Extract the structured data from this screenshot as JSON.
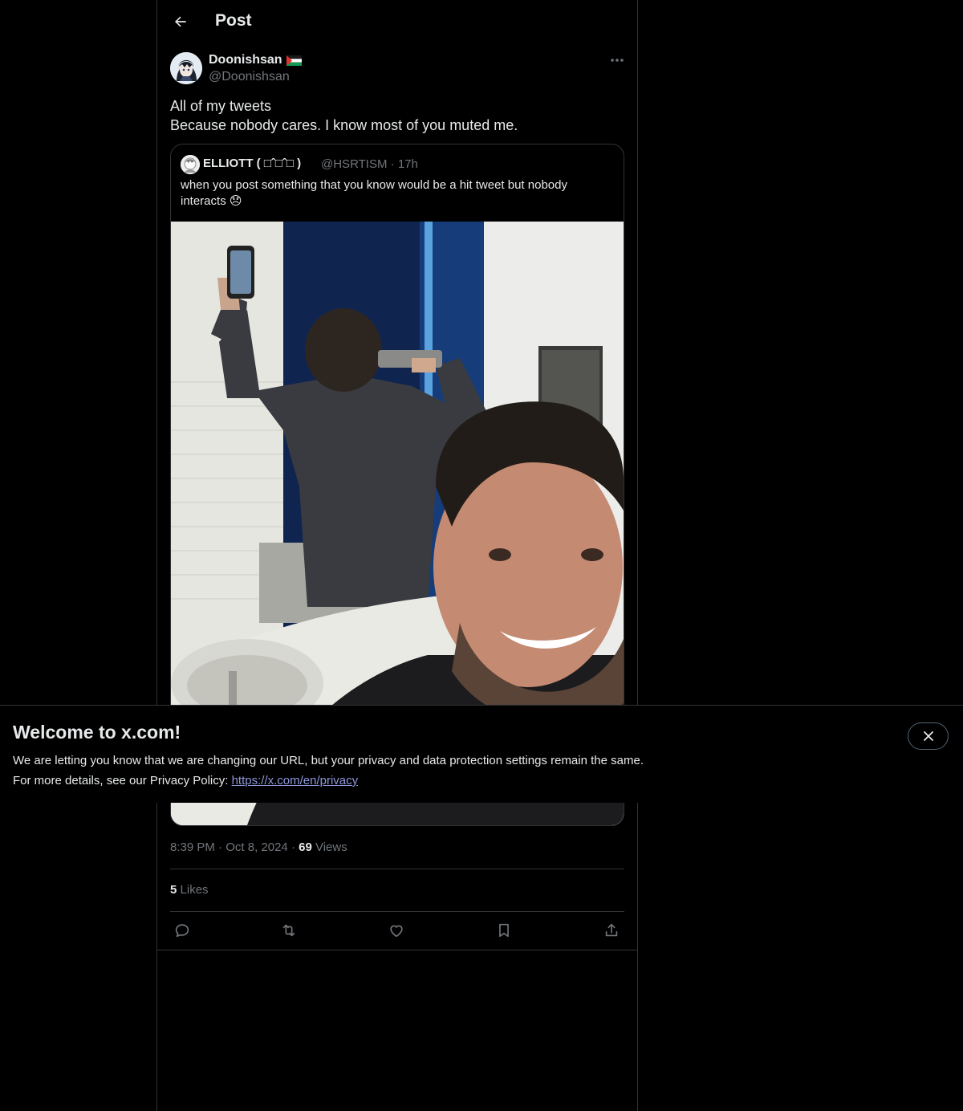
{
  "header": {
    "title": "Post"
  },
  "tweet": {
    "author_name": "Doonishsan",
    "author_flag": "🇵🇸",
    "author_handle": "@Doonishsan",
    "text_line_1": "All of my tweets",
    "text_line_2": "Because nobody cares. I know most of you muted me.",
    "time": "8:39 PM",
    "date": "Oct 8, 2024",
    "views_count": "69",
    "views_label": "Views",
    "likes_count": "5",
    "likes_label": "Likes"
  },
  "quote": {
    "name": "ELLIOTT ( □ˆ□ˆ□ )",
    "handle": "@HSRTISM",
    "time": "17h",
    "text": "when you post something that you know would be a hit tweet but nobody interacts",
    "emoji": "😞"
  },
  "banner": {
    "title": "Welcome to x.com!",
    "line1": "We are letting you know that we are changing our URL, but your privacy and data protection settings remain the same.",
    "line2_prefix": "For more details, see our Privacy Policy: ",
    "link": "https://x.com/en/privacy"
  },
  "icons": {
    "back": "arrow-left-icon",
    "more": "ellipsis-icon",
    "reply": "reply-icon",
    "repost": "repost-icon",
    "like": "heart-icon",
    "bookmark": "bookmark-icon",
    "share": "share-icon",
    "close": "close-icon"
  },
  "colors": {
    "background": "#000000",
    "text": "#e7e9ea",
    "secondary_text": "#71767b",
    "border": "#2f3336",
    "link": "#8e97d9"
  }
}
